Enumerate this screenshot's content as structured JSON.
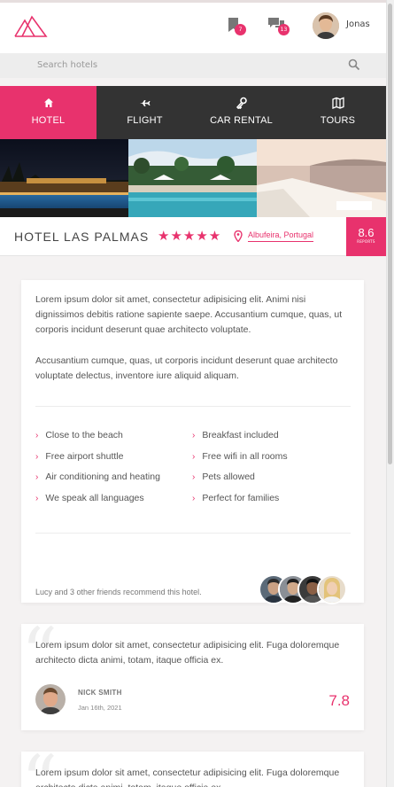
{
  "header": {
    "user_name": "Jonas",
    "bookmark_badge": "7",
    "messages_badge": "13"
  },
  "search": {
    "placeholder": "Search hotels"
  },
  "nav": {
    "items": [
      {
        "label": "HOTEL",
        "icon": "home-icon",
        "active": true
      },
      {
        "label": "FLIGHT",
        "icon": "plane-icon",
        "active": false
      },
      {
        "label": "CAR RENTAL",
        "icon": "key-icon",
        "active": false
      },
      {
        "label": "TOURS",
        "icon": "map-icon",
        "active": false
      }
    ]
  },
  "hotel": {
    "name": "HOTEL LAS PALMAS",
    "stars": "★★★★★",
    "star_count": 5,
    "location": "Albufeira, Portugal",
    "score": "8.6",
    "score_label": "REPORTS"
  },
  "description": {
    "p1": "Lorem ipsum dolor sit amet, consectetur adipisicing elit. Animi nisi dignissimos debitis ratione sapiente saepe. Accusantium cumque, quas, ut corporis incidunt deserunt quae architecto voluptate.",
    "p2": "Accusantium cumque, quas, ut corporis incidunt deserunt quae architecto voluptate delectus, inventore iure aliquid aliquam."
  },
  "amenities": [
    "Close to the beach",
    "Breakfast included",
    "Free airport shuttle",
    "Free wifi in all rooms",
    "Air conditioning and heating",
    "Pets allowed",
    "We speak all languages",
    "Perfect for families"
  ],
  "recommend_text": "Lucy and 3 other friends recommend this hotel.",
  "reviews": [
    {
      "text": "Lorem ipsum dolor sit amet, consectetur adipisicing elit. Fuga doloremque architecto dicta animi, totam, itaque officia ex.",
      "name": "NICK SMITH",
      "date": "Jan 16th, 2021",
      "score": "7.8"
    },
    {
      "text": "Lorem ipsum dolor sit amet, consectetur adipisicing elit. Fuga doloremque architecto dicta animi, totam, itaque officia ex."
    }
  ],
  "colors": {
    "accent": "#e8326d",
    "nav_bg": "#333333"
  }
}
